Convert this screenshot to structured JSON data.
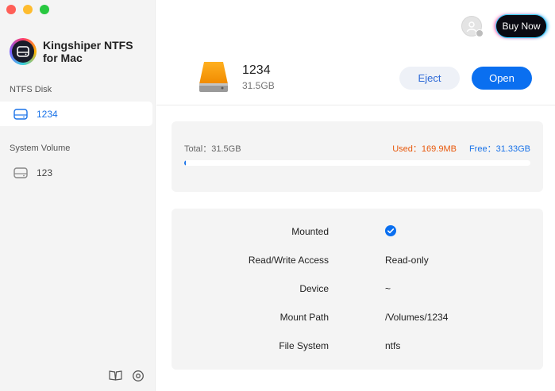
{
  "app": {
    "name": "Kingshiper NTFS for Mac"
  },
  "sidebar": {
    "sections": [
      {
        "label": "NTFS Disk",
        "items": [
          {
            "label": "1234",
            "active": true
          }
        ]
      },
      {
        "label": "System Volume",
        "items": [
          {
            "label": "123",
            "active": false
          }
        ]
      }
    ]
  },
  "header": {
    "buy_label": "Buy Now"
  },
  "disk": {
    "name": "1234",
    "size": "31.5GB",
    "eject_label": "Eject",
    "open_label": "Open"
  },
  "usage": {
    "total_text": "Total：31.5GB",
    "used_text": "Used：169.9MB",
    "free_text": "Free：31.33GB",
    "used_fraction": 0.005
  },
  "info": {
    "rows": [
      {
        "label": "Mounted",
        "value": "",
        "check": true
      },
      {
        "label": "Read/Write Access",
        "value": "Read-only"
      },
      {
        "label": "Device",
        "value": "~"
      },
      {
        "label": "Mount Path",
        "value": "/Volumes/1234"
      },
      {
        "label": "File System",
        "value": "ntfs"
      }
    ]
  },
  "colors": {
    "accent": "#0a6ff0",
    "used": "#e8590c",
    "free": "#1a73e8",
    "close": "#ff5f57",
    "minimize": "#febc2e",
    "maximize": "#28c840"
  },
  "icons": {
    "disk": "external-drive-icon",
    "user": "user-avatar-icon",
    "manual": "book-icon",
    "settings": "gear-icon",
    "check": "check-circle-icon"
  }
}
